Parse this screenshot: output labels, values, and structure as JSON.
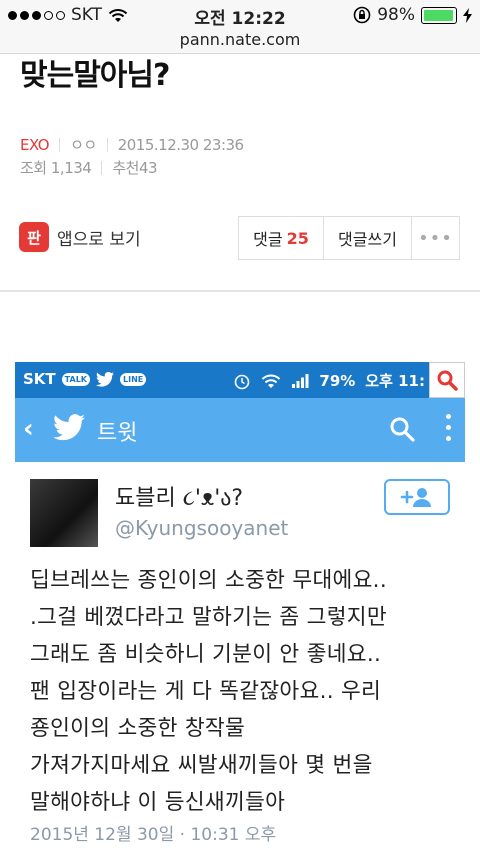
{
  "status_bar": {
    "carrier": "SKT",
    "time": "오전 12:22",
    "battery_percent": "98%",
    "battery_level": 0.98
  },
  "url_bar": {
    "url": "pann.nate.com"
  },
  "post": {
    "title": "맞는말아님?",
    "category": "EXO",
    "author": "ㅇㅇ",
    "datetime": "2015.12.30 23:36",
    "views_label": "조회",
    "views": "1,134",
    "recommend_label": "추천",
    "recommends": "43"
  },
  "actions": {
    "app_icon_text": "판",
    "app_view_label": "앱으로 보기",
    "comments_label": "댓글",
    "comments_count": "25",
    "write_comment_label": "댓글쓰기",
    "more_label": "•••"
  },
  "embedded": {
    "status": {
      "carrier": "SKT",
      "talk_badge": "TALK",
      "line_badge": "LINE",
      "battery": "79%",
      "time": "오후 11:"
    },
    "header": {
      "title": "트윗"
    },
    "user": {
      "name": "됴블리 ૮'ᴥ'ა?",
      "handle": "@Kyungsooyanet"
    },
    "tweet_lines": [
      "딥브레쓰는 종인이의 소중한 무대에요..",
      ".그걸 베꼈다라고 말하기는 좀 그렇지만",
      "그래도 좀 비슷하니 기분이 안 좋네요..",
      "팬 입장이라는 게 다 똑같잖아요.. 우리",
      "죵인이의 소중한 창작물",
      "가져가지마세요 씨발새끼들아 몇 번을",
      "말해야하냐 이 등신새끼들아"
    ],
    "tweet_date": "2015년 12월 30일 · 10:31 오후"
  },
  "colors": {
    "accent_red": "#e53935",
    "twitter_blue": "#55acee",
    "status_blue": "#1a78c8",
    "battery_green": "#4cd964"
  }
}
